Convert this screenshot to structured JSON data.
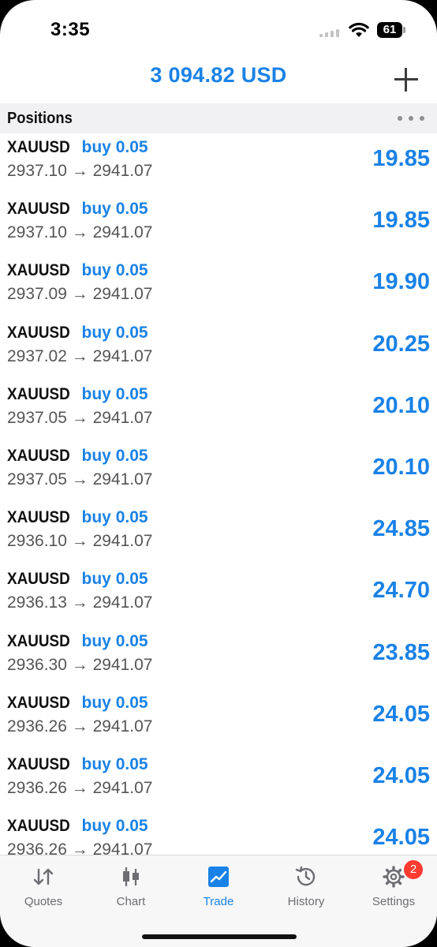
{
  "status": {
    "time": "3:35",
    "battery": "61"
  },
  "header": {
    "balance": "3 094.82 USD",
    "add_icon": "plus-icon"
  },
  "section": {
    "title": "Positions",
    "more_icon": "ellipsis-icon"
  },
  "positions": [
    {
      "symbol": "XAUUSD",
      "side": "buy 0.05",
      "prices": "2937.10 → 2941.07",
      "profit": "19.85"
    },
    {
      "symbol": "XAUUSD",
      "side": "buy 0.05",
      "prices": "2937.10 → 2941.07",
      "profit": "19.85"
    },
    {
      "symbol": "XAUUSD",
      "side": "buy 0.05",
      "prices": "2937.09 → 2941.07",
      "profit": "19.90"
    },
    {
      "symbol": "XAUUSD",
      "side": "buy 0.05",
      "prices": "2937.02 → 2941.07",
      "profit": "20.25"
    },
    {
      "symbol": "XAUUSD",
      "side": "buy 0.05",
      "prices": "2937.05 → 2941.07",
      "profit": "20.10"
    },
    {
      "symbol": "XAUUSD",
      "side": "buy 0.05",
      "prices": "2937.05 → 2941.07",
      "profit": "20.10"
    },
    {
      "symbol": "XAUUSD",
      "side": "buy 0.05",
      "prices": "2936.10 → 2941.07",
      "profit": "24.85"
    },
    {
      "symbol": "XAUUSD",
      "side": "buy 0.05",
      "prices": "2936.13 → 2941.07",
      "profit": "24.70"
    },
    {
      "symbol": "XAUUSD",
      "side": "buy 0.05",
      "prices": "2936.30 → 2941.07",
      "profit": "23.85"
    },
    {
      "symbol": "XAUUSD",
      "side": "buy 0.05",
      "prices": "2936.26 → 2941.07",
      "profit": "24.05"
    },
    {
      "symbol": "XAUUSD",
      "side": "buy 0.05",
      "prices": "2936.26 → 2941.07",
      "profit": "24.05"
    },
    {
      "symbol": "XAUUSD",
      "side": "buy 0.05",
      "prices": "2936.26 → 2941.07",
      "profit": "24.05"
    }
  ],
  "tabs": [
    {
      "label": "Quotes",
      "icon": "arrows-updown-icon",
      "active": false
    },
    {
      "label": "Chart",
      "icon": "candlestick-icon",
      "active": false
    },
    {
      "label": "Trade",
      "icon": "trade-chart-icon",
      "active": true
    },
    {
      "label": "History",
      "icon": "history-clock-icon",
      "active": false
    },
    {
      "label": "Settings",
      "icon": "gear-icon",
      "active": false,
      "badge": "2"
    }
  ],
  "colors": {
    "accent": "#1a82e6",
    "badge": "#ff3b30"
  }
}
